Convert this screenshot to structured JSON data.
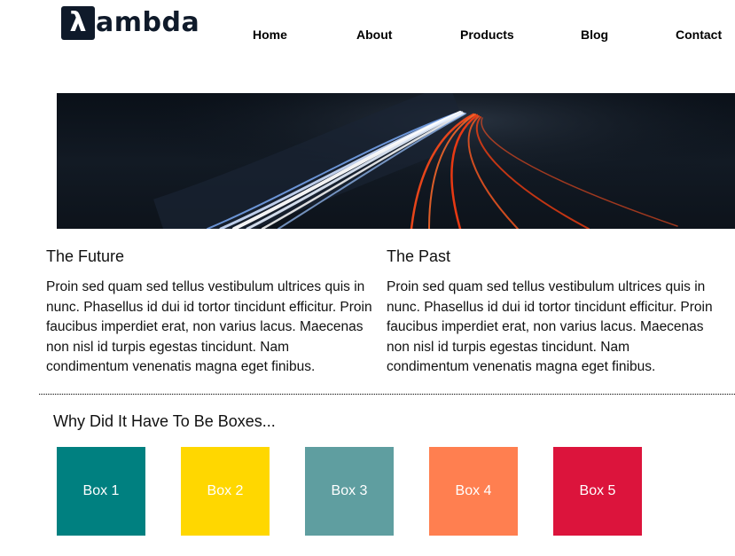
{
  "logo": {
    "glyph": "λ",
    "text": "ambda"
  },
  "nav": [
    "Home",
    "About",
    "Products",
    "Blog",
    "Contact"
  ],
  "columns": [
    {
      "title": "The Future",
      "body": "Proin sed quam sed tellus vestibulum ultrices quis in nunc. Phasellus id dui id tortor tincidunt efficitur. Proin faucibus imperdiet erat, non varius lacus. Maecenas non nisl id turpis egestas tincidunt. Nam condimentum venenatis magna eget finibus."
    },
    {
      "title": "The Past",
      "body": "Proin sed quam sed tellus vestibulum ultrices quis in nunc. Phasellus id dui id tortor tincidunt efficitur. Proin faucibus imperdiet erat, non varius lacus. Maecenas non nisl id turpis egestas tincidunt. Nam condimentum venenatis magna eget finibus."
    }
  ],
  "boxes_title": "Why Did It Have To Be Boxes...",
  "boxes": [
    {
      "label": "Box 1",
      "color": "#008080"
    },
    {
      "label": "Box 2",
      "color": "#ffd700"
    },
    {
      "label": "Box 3",
      "color": "#5f9ea0"
    },
    {
      "label": "Box 4",
      "color": "#ff7f50"
    },
    {
      "label": "Box 5",
      "color": "#dc143c"
    }
  ]
}
